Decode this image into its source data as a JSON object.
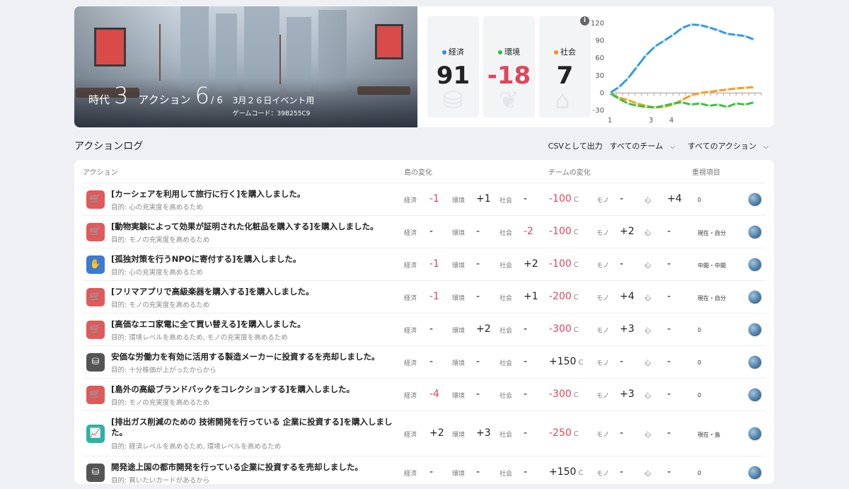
{
  "hero": {
    "era_label": "時代",
    "era_value": "3",
    "action_label": "アクション",
    "action_value": "6",
    "action_total": "/ 6",
    "event_title": "3月２６日イベント用",
    "game_code": "ゲームコード：39B255C9"
  },
  "scores": [
    {
      "name": "経済",
      "value": "91",
      "color": "#2f8de4",
      "icon": "coins-icon"
    },
    {
      "name": "環境",
      "value": "-18",
      "color": "#3cb44b",
      "icon": "leaf-icon"
    },
    {
      "name": "社会",
      "value": "7",
      "color": "#f0921e",
      "icon": "building-icon"
    }
  ],
  "chart_data": {
    "type": "line",
    "yticks": [
      "120",
      "90",
      "60",
      "30",
      "0",
      "-30"
    ],
    "xticks": [
      "1",
      "3",
      "4"
    ],
    "ylim": [
      -30,
      120
    ],
    "series": [
      {
        "color": "#2f9be4",
        "values": [
          0,
          10,
          25,
          45,
          65,
          80,
          90,
          100,
          112,
          118,
          117,
          113,
          108,
          102,
          100,
          98,
          92
        ]
      },
      {
        "color": "#f0a020",
        "values": [
          0,
          -8,
          -12,
          -18,
          -22,
          -25,
          -24,
          -20,
          -12,
          -4,
          0,
          2,
          4,
          6,
          8,
          9,
          10
        ]
      },
      {
        "color": "#3cc03c",
        "values": [
          0,
          -10,
          -18,
          -22,
          -24,
          -25,
          -22,
          -18,
          -16,
          -20,
          -18,
          -22,
          -20,
          -24,
          -18,
          -20,
          -16
        ]
      }
    ]
  },
  "log": {
    "title": "アクションログ",
    "csv": "CSVとして出力",
    "team_filter": "すべてのチーム",
    "action_filter": "すべてのアクション"
  },
  "table": {
    "headers": {
      "action": "アクション",
      "island": "島の変化",
      "team": "チームの変化",
      "important": "重視項目"
    },
    "labels": {
      "eco": "経済",
      "env": "環境",
      "soc": "社会",
      "mono": "モノ",
      "kokoro": "心",
      "c": "C"
    },
    "rows": [
      {
        "icon": "cart-icon",
        "icon_color": "#e05a5a",
        "title": "[カーシェアを利用して旅行に行く]を購入しました。",
        "purpose": "目的: 心の充実度を高めるため",
        "eco": "-1",
        "env": "+1",
        "soc": "-",
        "c": "-100",
        "mono": "-",
        "kokoro": "+4",
        "important": "0"
      },
      {
        "icon": "cart-icon",
        "icon_color": "#e05a5a",
        "title": "[動物実験によって効果が証明された化粧品を購入する]を購入しました。",
        "purpose": "目的: モノの充実度を高めるため",
        "eco": "-",
        "env": "-",
        "soc": "-2",
        "c": "-100",
        "mono": "+2",
        "kokoro": "-",
        "important": "現在・自分"
      },
      {
        "icon": "hand-icon",
        "icon_color": "#3a7bd5",
        "title": "[孤独対策を行うNPOに寄付する]を購入しました。",
        "purpose": "目的: 心の充実度を高めるため",
        "eco": "-1",
        "env": "-",
        "soc": "+2",
        "c": "-100",
        "mono": "-",
        "kokoro": "-",
        "important": "中間・中間"
      },
      {
        "icon": "cart-icon",
        "icon_color": "#e05a5a",
        "title": "[フリマアプリで高級楽器を購入する]を購入しました。",
        "purpose": "目的: モノの充実度を高めるため",
        "eco": "-1",
        "env": "-",
        "soc": "+1",
        "c": "-200",
        "mono": "+4",
        "kokoro": "-",
        "important": "現在・自分"
      },
      {
        "icon": "cart-icon",
        "icon_color": "#e05a5a",
        "title": "[高価なエコ家電に全て買い替える]を購入しました。",
        "purpose": "目的: 環境レベルを高めるため, モノの充実度を高めるため",
        "eco": "-",
        "env": "+2",
        "soc": "-",
        "c": "-300",
        "mono": "+3",
        "kokoro": "-",
        "important": "0"
      },
      {
        "icon": "coins-icon",
        "icon_color": "#555555",
        "title": "安価な労働力を有効に活用する製造メーカーに投資するを売却しました。",
        "purpose": "目的: 十分株価が上がったからから",
        "eco": "-",
        "env": "-",
        "soc": "-",
        "c": "+150",
        "mono": "-",
        "kokoro": "-",
        "important": "0"
      },
      {
        "icon": "cart-icon",
        "icon_color": "#e05a5a",
        "title": "[島外の高級ブランドバックをコレクションする]を購入しました。",
        "purpose": "目的: モノの充実度を高めるため",
        "eco": "-4",
        "env": "-",
        "soc": "-",
        "c": "-300",
        "mono": "+3",
        "kokoro": "-",
        "important": "0"
      },
      {
        "icon": "chart-icon",
        "icon_color": "#2bb3a3",
        "title": "[排出ガス削減のための 技術開発を行っている 企業に投資する]を購入しました。",
        "purpose": "目的: 経済レベルを高めるため, 環境レベルを高めるため",
        "eco": "+2",
        "env": "+3",
        "soc": "-",
        "c": "-250",
        "mono": "-",
        "kokoro": "-",
        "important": "現在・島"
      },
      {
        "icon": "coins-icon",
        "icon_color": "#555555",
        "title": "開発途上国の都市開発を行っている企業に投資するを売却しました。",
        "purpose": "目的: 買いたいカードがあるから",
        "eco": "-",
        "env": "-",
        "soc": "-",
        "c": "+150",
        "mono": "-",
        "kokoro": "-",
        "important": "0"
      }
    ]
  }
}
